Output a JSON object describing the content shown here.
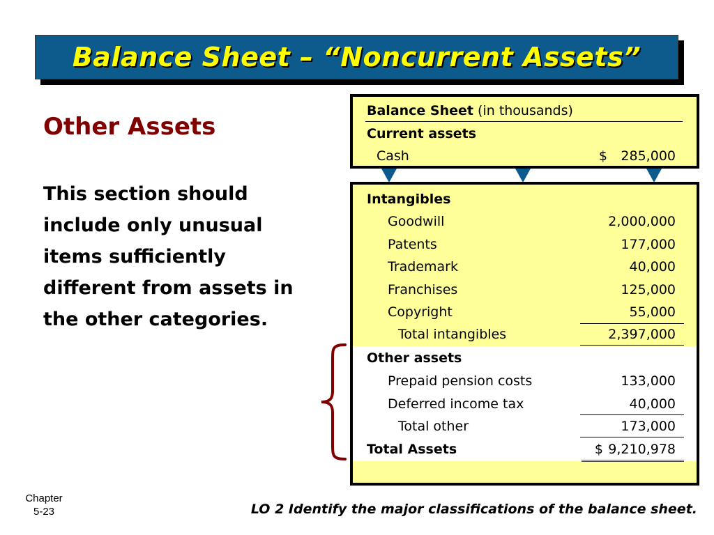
{
  "slide": {
    "title": "Balance Sheet – “Noncurrent Assets”",
    "subtitle": "Other Assets",
    "body": "This section should include only unusual items sufficiently different from assets in the other categories.",
    "footer": {
      "chapter_label": "Chapter",
      "slide_number": "5-23",
      "learning_objective": "LO 2 Identify the major classifications of the balance sheet."
    },
    "colors": {
      "title_bar": "#0d5a8c",
      "title_text": "#ffff00",
      "subtitle": "#800000",
      "box_fill": "#ffff99",
      "arrow": "#0d5a8c",
      "brace": "#800000"
    }
  },
  "balance_sheet": {
    "header_bold": "Balance Sheet",
    "header_note": "(in thousands)",
    "current_assets": {
      "heading": "Current assets",
      "items": [
        {
          "label": "Cash",
          "currency": "$",
          "value": "285,000"
        }
      ]
    },
    "intangibles": {
      "heading": "Intangibles",
      "items": [
        {
          "label": "Goodwill",
          "value": "2,000,000"
        },
        {
          "label": "Patents",
          "value": "177,000"
        },
        {
          "label": "Trademark",
          "value": "40,000"
        },
        {
          "label": "Franchises",
          "value": "125,000"
        },
        {
          "label": "Copyright",
          "value": "55,000"
        }
      ],
      "total_label": "Total intangibles",
      "total_value": "2,397,000"
    },
    "other_assets": {
      "heading": "Other assets",
      "items": [
        {
          "label": "Prepaid pension costs",
          "value": "133,000"
        },
        {
          "label": "Deferred income tax",
          "value": "40,000"
        }
      ],
      "total_label": "Total other",
      "total_value": "173,000"
    },
    "total_assets": {
      "label": "Total Assets",
      "currency": "$",
      "value": "9,210,978"
    }
  }
}
